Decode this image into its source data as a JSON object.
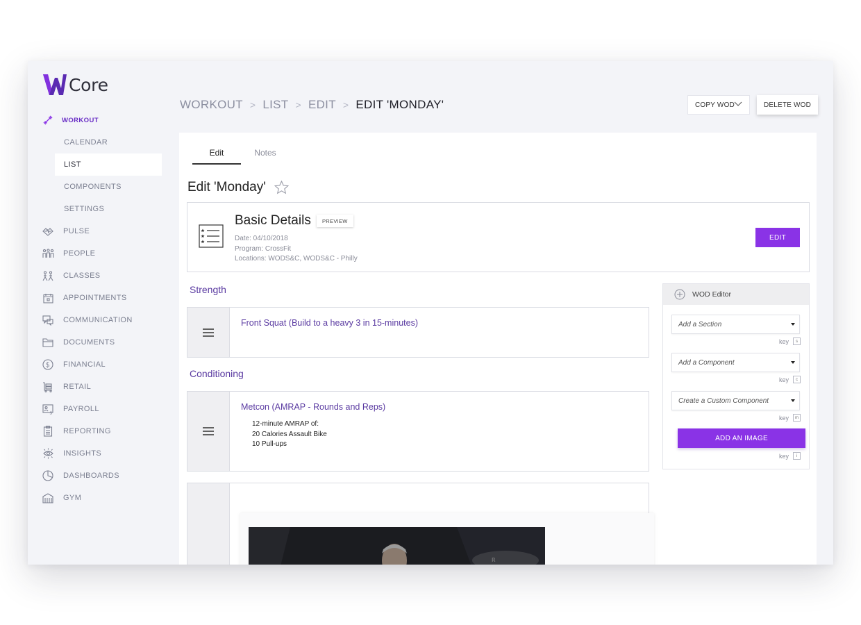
{
  "brand": {
    "name": "Core",
    "accent": "#8a33e6",
    "logo_purple": "#5a2ab2"
  },
  "sidebar": {
    "items": [
      {
        "label": "WORKOUT",
        "icon": "dumbbell-icon",
        "state": "active-parent"
      },
      {
        "label": "CALENDAR",
        "icon": "",
        "state": "sub"
      },
      {
        "label": "LIST",
        "icon": "",
        "state": "selected"
      },
      {
        "label": "COMPONENTS",
        "icon": "",
        "state": "sub"
      },
      {
        "label": "SETTINGS",
        "icon": "",
        "state": "sub"
      },
      {
        "label": "PULSE",
        "icon": "pulse-icon",
        "state": "normal"
      },
      {
        "label": "PEOPLE",
        "icon": "people-icon",
        "state": "normal"
      },
      {
        "label": "CLASSES",
        "icon": "classes-icon",
        "state": "normal"
      },
      {
        "label": "APPOINTMENTS",
        "icon": "calendar-icon",
        "state": "normal"
      },
      {
        "label": "COMMUNICATION",
        "icon": "chat-icon",
        "state": "normal"
      },
      {
        "label": "DOCUMENTS",
        "icon": "folder-icon",
        "state": "normal"
      },
      {
        "label": "FINANCIAL",
        "icon": "dollar-icon",
        "state": "normal"
      },
      {
        "label": "RETAIL",
        "icon": "cart-icon",
        "state": "normal"
      },
      {
        "label": "PAYROLL",
        "icon": "payroll-icon",
        "state": "normal"
      },
      {
        "label": "REPORTING",
        "icon": "clipboard-icon",
        "state": "normal"
      },
      {
        "label": "INSIGHTS",
        "icon": "eye-icon",
        "state": "normal"
      },
      {
        "label": "DASHBOARDS",
        "icon": "pie-chart-icon",
        "state": "normal"
      },
      {
        "label": "GYM",
        "icon": "building-icon",
        "state": "normal"
      }
    ]
  },
  "header": {
    "breadcrumb": [
      "WORKOUT",
      "LIST",
      "EDIT",
      "EDIT 'MONDAY'"
    ],
    "copy_label": "COPY WOD",
    "delete_label": "DELETE WOD"
  },
  "tabs": [
    {
      "label": "Edit",
      "active": true
    },
    {
      "label": "Notes",
      "active": false
    }
  ],
  "page": {
    "title": "Edit 'Monday'"
  },
  "details": {
    "title": "Basic Details",
    "preview_label": "PREVIEW",
    "date": "Date: 04/10/2018",
    "program": "Program: CrossFit",
    "locations": "Locations:  WODS&C, WODS&C - Philly",
    "edit_label": "EDIT"
  },
  "sections": [
    {
      "title": "Strength",
      "component": {
        "title": "Front Squat (Build to a heavy 3 in 15-minutes)",
        "lines": []
      }
    },
    {
      "title": "Conditioning",
      "component": {
        "title": "Metcon (AMRAP - Rounds and Reps)",
        "lines": [
          "12-minute AMRAP of:",
          "20 Calories Assault Bike",
          "10 Pull-ups"
        ]
      }
    }
  ],
  "wod_editor": {
    "title": "WOD Editor",
    "add_section": "Add a Section",
    "add_component": "Add a Component",
    "custom_component": "Create a Custom Component",
    "add_image": "ADD AN IMAGE",
    "key_label": "key",
    "keys": [
      "s",
      "c",
      "m",
      "i"
    ]
  }
}
